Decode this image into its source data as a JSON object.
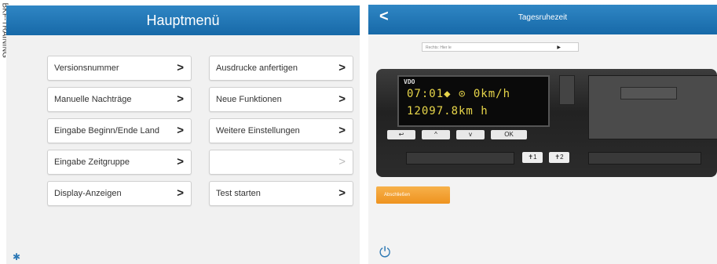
{
  "side_label": "BKF-TRAINING",
  "left_panel": {
    "title": "Hauptmenü",
    "buttons": [
      {
        "label": "Versionsnummer",
        "enabled": true
      },
      {
        "label": "Ausdrucke anfertigen",
        "enabled": true
      },
      {
        "label": "Manuelle Nachträge",
        "enabled": true
      },
      {
        "label": "Neue Funktionen",
        "enabled": true
      },
      {
        "label": "Eingabe Beginn/Ende Land",
        "enabled": true
      },
      {
        "label": "Weitere Einstellungen",
        "enabled": true
      },
      {
        "label": "Eingabe Zeitgruppe",
        "enabled": true
      },
      {
        "label": "",
        "enabled": false
      },
      {
        "label": "Display-Anzeigen",
        "enabled": true
      },
      {
        "label": "Test starten",
        "enabled": true
      }
    ],
    "chevron": ">",
    "corner_icon": "settings-icon"
  },
  "right_panel": {
    "title": "Tagesruhezeit",
    "back_symbol": "<",
    "dropdown_value": "Rechts: Hier le",
    "device": {
      "brand": "VDO",
      "line1": "07:01◆ ⊙   0km/h",
      "line2": "  12097.8km  h",
      "buttons": [
        "↩",
        "^",
        "v",
        "OK"
      ],
      "card_buttons": [
        "1",
        "2"
      ]
    },
    "action_button": "Abschließen",
    "power_icon": "power-icon"
  },
  "colors": {
    "header_blue": "#1769a8",
    "orange": "#ee9320",
    "lcd_text": "#e8d64a"
  }
}
